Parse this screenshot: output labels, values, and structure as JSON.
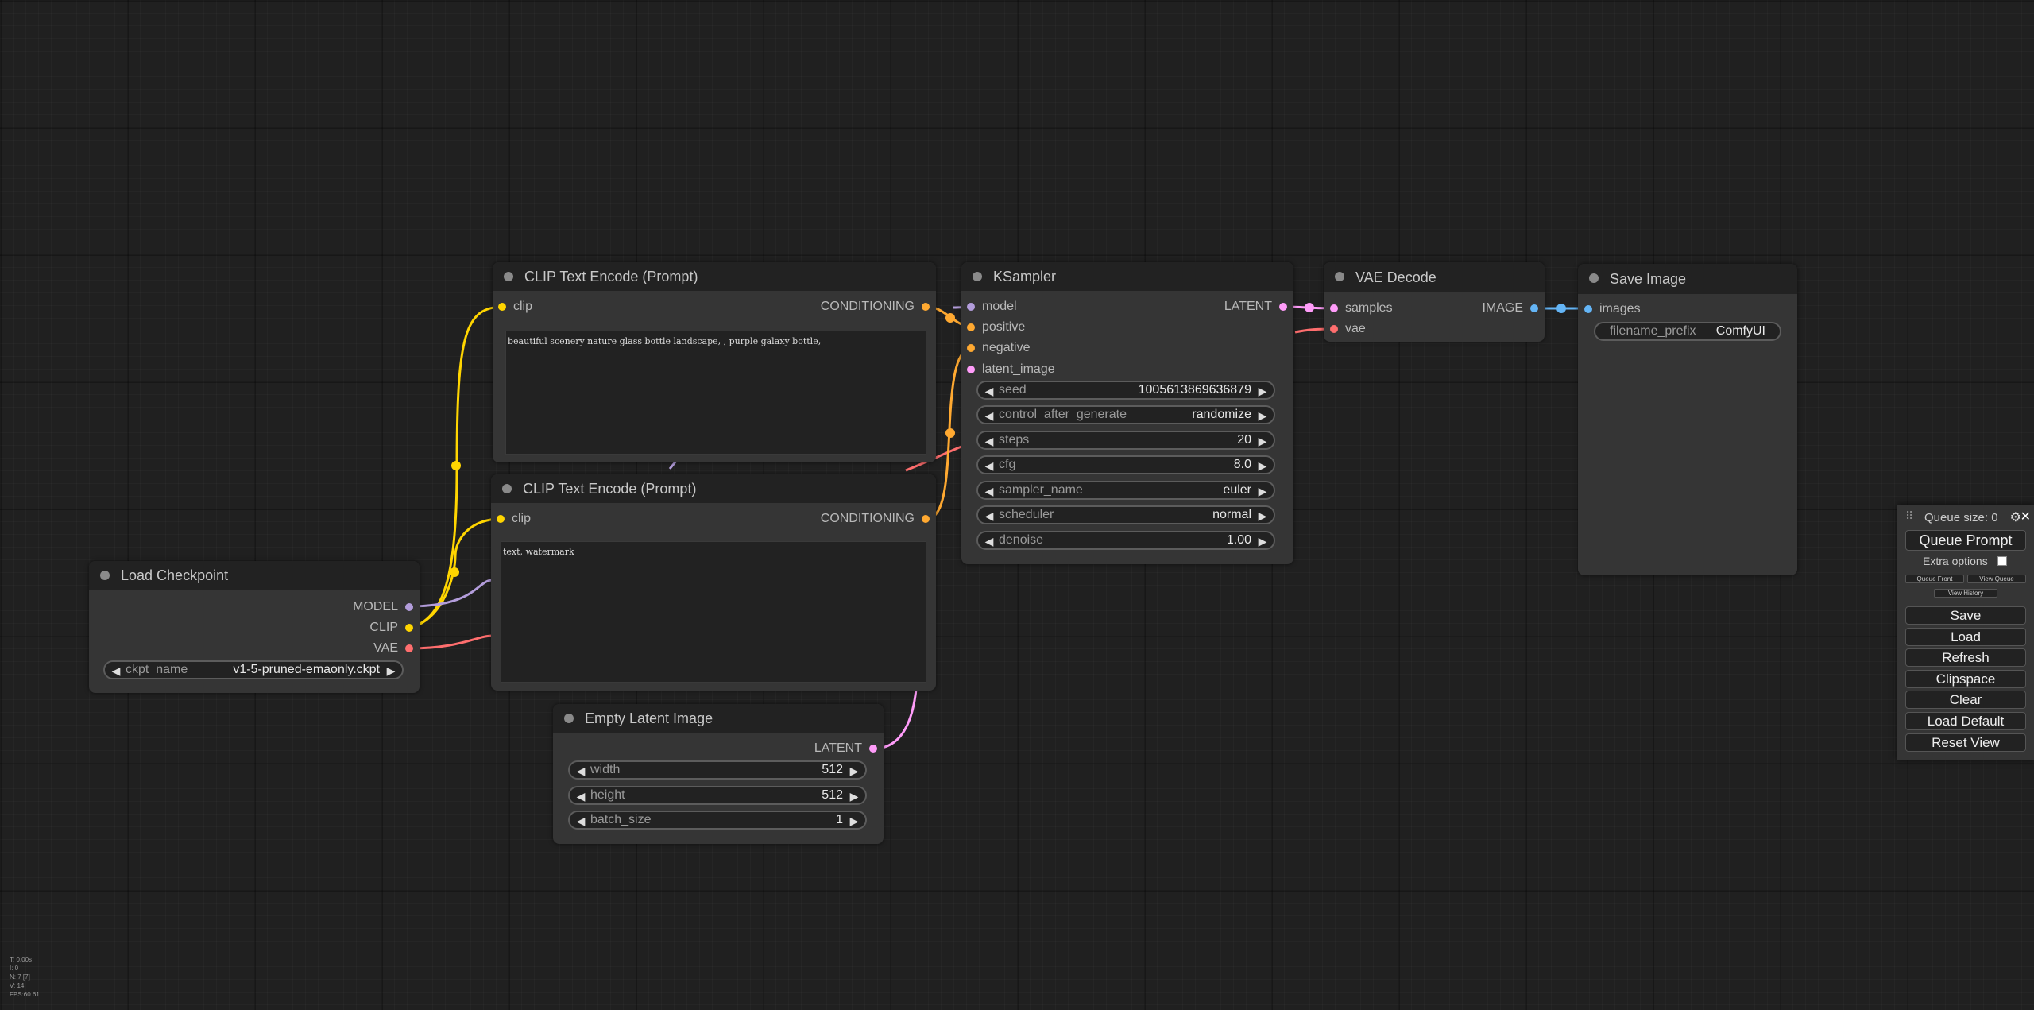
{
  "colors": {
    "clip": "#ffd500",
    "conditioning": "#ffa931",
    "model": "#b39ddb",
    "vae": "#ff6e6e",
    "latent": "#ff9cf9",
    "image": "#64b5f6"
  },
  "nodes": {
    "load_checkpoint": {
      "title": "Load Checkpoint",
      "outputs": [
        "MODEL",
        "CLIP",
        "VAE"
      ],
      "ckpt_name_label": "ckpt_name",
      "ckpt_name_value": "v1-5-pruned-emaonly.ckpt"
    },
    "clip_pos": {
      "title": "CLIP Text Encode (Prompt)",
      "input": "clip",
      "output": "CONDITIONING",
      "text": "beautiful scenery nature glass bottle landscape, , purple galaxy bottle,"
    },
    "clip_neg": {
      "title": "CLIP Text Encode (Prompt)",
      "input": "clip",
      "output": "CONDITIONING",
      "text": "text, watermark"
    },
    "ksampler": {
      "title": "KSampler",
      "inputs": [
        "model",
        "positive",
        "negative",
        "latent_image"
      ],
      "output": "LATENT",
      "widgets": [
        {
          "name": "seed",
          "value": "1005613869636879"
        },
        {
          "name": "control_after_generate",
          "value": "randomize"
        },
        {
          "name": "steps",
          "value": "20"
        },
        {
          "name": "cfg",
          "value": "8.0"
        },
        {
          "name": "sampler_name",
          "value": "euler"
        },
        {
          "name": "scheduler",
          "value": "normal"
        },
        {
          "name": "denoise",
          "value": "1.00"
        }
      ]
    },
    "vae_decode": {
      "title": "VAE Decode",
      "inputs": [
        "samples",
        "vae"
      ],
      "output": "IMAGE"
    },
    "save_image": {
      "title": "Save Image",
      "input": "images",
      "prefix_label": "filename_prefix",
      "prefix_value": "ComfyUI"
    },
    "empty_latent": {
      "title": "Empty Latent Image",
      "output": "LATENT",
      "widgets": [
        {
          "name": "width",
          "value": "512"
        },
        {
          "name": "height",
          "value": "512"
        },
        {
          "name": "batch_size",
          "value": "1"
        }
      ]
    }
  },
  "menu": {
    "queue_size": "Queue size: 0",
    "gear_icon": "gear-icon",
    "close_icon": "close-icon",
    "queue_prompt": "Queue Prompt",
    "extra_options": "Extra options",
    "queue_front": "Queue Front",
    "view_queue": "View Queue",
    "view_history": "View History",
    "save": "Save",
    "load": "Load",
    "refresh": "Refresh",
    "clipspace": "Clipspace",
    "clear": "Clear",
    "load_default": "Load Default",
    "reset_view": "Reset View"
  },
  "stats": [
    "T: 0.00s",
    "I: 0",
    "N: 7 [7]",
    "V: 14",
    "FPS:60.61"
  ]
}
